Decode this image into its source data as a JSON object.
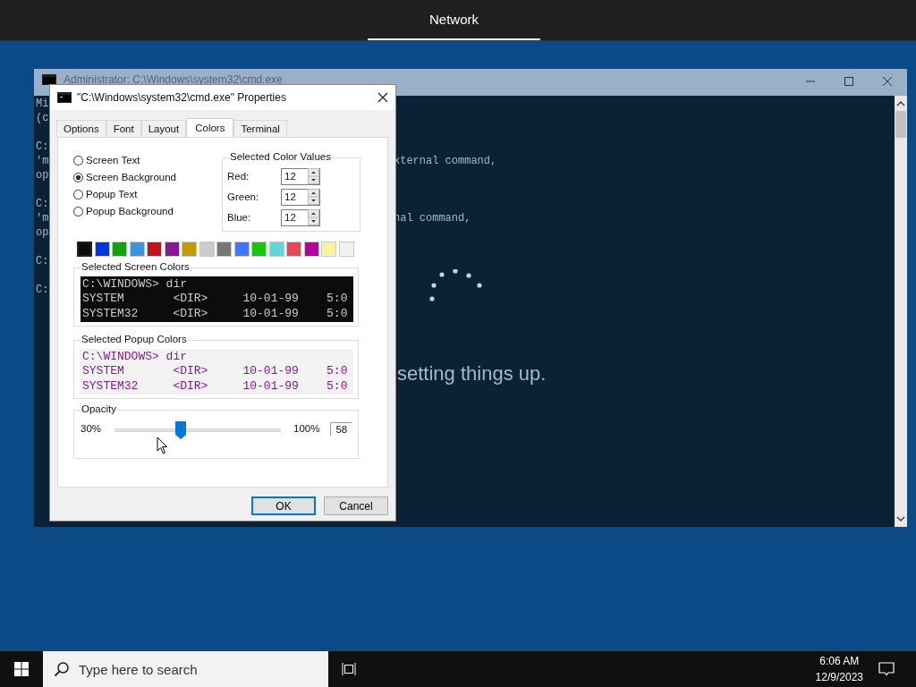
{
  "top_bar": {
    "tabs": [
      {
        "label": "Network",
        "selected": true
      }
    ]
  },
  "console": {
    "title": "Administrator: C:\\Windows\\system32\\cmd.exe",
    "blocks": [
      [
        {
          "left": "Mi"
        },
        {
          "left": "(c"
        }
      ],
      [
        {
          "left": "C:"
        },
        {
          "left": "'m",
          "right": "xternal command,"
        },
        {
          "left": "op"
        }
      ],
      [
        {
          "left": "C:"
        },
        {
          "left": "'m",
          "right": "nal command,"
        },
        {
          "left": "op"
        }
      ],
      [
        {
          "left": "C:"
        }
      ],
      [
        {
          "left": "C:"
        }
      ]
    ],
    "status": "setting things up."
  },
  "dialog": {
    "title": "\"C:\\Windows\\system32\\cmd.exe\" Properties",
    "tabs": [
      {
        "label": "Options",
        "selected": false
      },
      {
        "label": "Font",
        "selected": false
      },
      {
        "label": "Layout",
        "selected": false
      },
      {
        "label": "Colors",
        "selected": true
      },
      {
        "label": "Terminal",
        "selected": false
      }
    ],
    "radios": [
      {
        "label": "Screen Text",
        "selected": false
      },
      {
        "label": "Screen Background",
        "selected": true
      },
      {
        "label": "Popup Text",
        "selected": false
      },
      {
        "label": "Popup Background",
        "selected": false
      }
    ],
    "color_values": {
      "title": "Selected Color Values",
      "fields": [
        {
          "label": "Red:",
          "value": "12"
        },
        {
          "label": "Green:",
          "value": "12"
        },
        {
          "label": "Blue:",
          "value": "12"
        }
      ]
    },
    "swatches": [
      {
        "color": "#0c0c0c",
        "selected": true
      },
      {
        "color": "#0037da",
        "selected": false
      },
      {
        "color": "#13a10e",
        "selected": false
      },
      {
        "color": "#3a96dd",
        "selected": false
      },
      {
        "color": "#c50f1f",
        "selected": false
      },
      {
        "color": "#881798",
        "selected": false
      },
      {
        "color": "#c19c00",
        "selected": false
      },
      {
        "color": "#cccccc",
        "selected": false
      },
      {
        "color": "#767676",
        "selected": false
      },
      {
        "color": "#3b78ff",
        "selected": false
      },
      {
        "color": "#16c60c",
        "selected": false
      },
      {
        "color": "#61d6d6",
        "selected": false
      },
      {
        "color": "#e74856",
        "selected": false
      },
      {
        "color": "#b4009e",
        "selected": false
      },
      {
        "color": "#f9f1a5",
        "selected": false
      },
      {
        "color": "#f2f2f2",
        "selected": false
      }
    ],
    "previews": [
      {
        "title": "Selected Screen Colors",
        "kind": "screen",
        "lines": [
          "C:\\WINDOWS> dir",
          "SYSTEM       <DIR>     10-01-99    5:0",
          "SYSTEM32     <DIR>     10-01-99    5:0"
        ]
      },
      {
        "title": "Selected Popup Colors",
        "kind": "popup",
        "lines": [
          "C:\\WINDOWS> dir",
          "SYSTEM       <DIR>     10-01-99    5:0",
          "SYSTEM32     <DIR>     10-01-99    5:0"
        ]
      }
    ],
    "opacity": {
      "title": "Opacity",
      "min_label": "30%",
      "max_label": "100%",
      "level": 0.4,
      "value": "58"
    },
    "buttons": [
      {
        "label": "OK",
        "default": true
      },
      {
        "label": "Cancel",
        "default": false
      }
    ]
  },
  "taskbar": {
    "search_placeholder": "Type here to search",
    "time": "6:06 AM",
    "date": "12/9/2023"
  }
}
